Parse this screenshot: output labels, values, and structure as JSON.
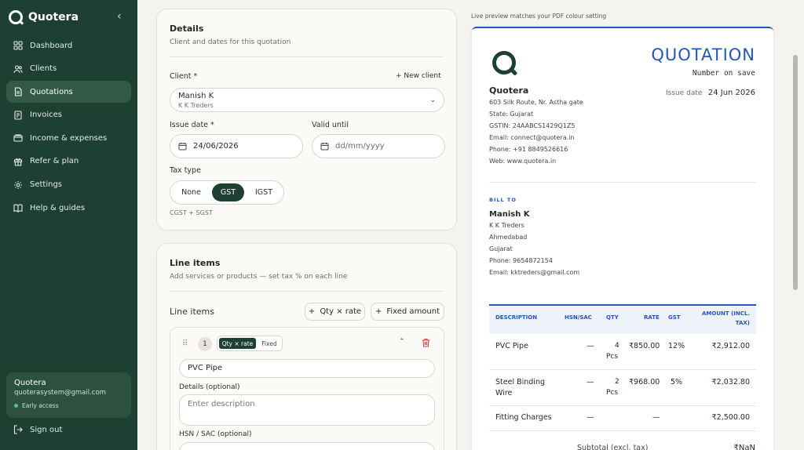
{
  "sidebar": {
    "brand": "Quotera",
    "items": [
      {
        "label": "Dashboard",
        "icon": "grid-icon",
        "active": false
      },
      {
        "label": "Clients",
        "icon": "users-icon",
        "active": false
      },
      {
        "label": "Quotations",
        "icon": "document-icon",
        "active": true
      },
      {
        "label": "Invoices",
        "icon": "invoice-icon",
        "active": false
      },
      {
        "label": "Income & expenses",
        "icon": "wallet-icon",
        "active": false
      },
      {
        "label": "Refer & plan",
        "icon": "gift-icon",
        "active": false
      },
      {
        "label": "Settings",
        "icon": "gear-icon",
        "active": false
      },
      {
        "label": "Help & guides",
        "icon": "book-icon",
        "active": false
      }
    ],
    "account": {
      "name": "Quotera",
      "email": "quoterasystem@gmail.com",
      "status": "Early access"
    },
    "signout": "Sign out"
  },
  "details": {
    "title": "Details",
    "subtitle": "Client and dates for this quotation",
    "client_label": "Client *",
    "new_client": "+ New client",
    "client_name": "Manish K",
    "client_company": "K K Treders",
    "issue_label": "Issue date *",
    "issue_value": "24/06/2026",
    "valid_label": "Valid until",
    "valid_placeholder": "dd/mm/yyyy",
    "tax_label": "Tax type",
    "tax_options": [
      "None",
      "GST",
      "IGST"
    ],
    "tax_selected": "GST",
    "tax_note": "CGST + SGST"
  },
  "line_items": {
    "title": "Line items",
    "subtitle": "Add services or products — set tax % on each line",
    "section_label": "Line items",
    "qty_rate_btn": "Qty × rate",
    "fixed_btn": "Fixed amount",
    "item": {
      "number": "1",
      "mode_options": [
        "Qty × rate",
        "Fixed"
      ],
      "mode_selected": "Qty × rate",
      "name": "PVC Pipe",
      "details_label": "Details (optional)",
      "details_placeholder": "Enter description",
      "hsn_label": "HSN / SAC  (optional)"
    }
  },
  "preview": {
    "note": "Live preview matches your PDF colour setting",
    "doc_title": "QUOTATION",
    "doc_number": "Number on save",
    "company": {
      "name": "Quotera",
      "lines": [
        "603 Silk Route, Nr. Astha gate",
        "State: Gujarat",
        "GSTIN: 24AABCS1429Q1Z5",
        "Email: connect@quotera.in",
        "Phone: +91 8849526616",
        "Web: www.quotera.in"
      ]
    },
    "issue_label": "Issue date",
    "issue_value": "24 Jun 2026",
    "bill_to_label": "BILL TO",
    "bill_to": {
      "name": "Manish K",
      "lines": [
        "K K Treders",
        "Ahmedabad",
        "Gujarat",
        "Phone: 9654872154",
        "Email: kktreders@gmail.com"
      ]
    },
    "table": {
      "headers": [
        "DESCRIPTION",
        "HSN/SAC",
        "QTY",
        "RATE",
        "GST",
        "AMOUNT (INCL.",
        "TAX)"
      ],
      "rows": [
        {
          "desc": [
            "PVC Pipe"
          ],
          "hsn": "—",
          "qty": [
            "4",
            "Pcs"
          ],
          "rate": "₹850.00",
          "gst": "12%",
          "amount": "₹2,912.00"
        },
        {
          "desc": [
            "Steel Binding",
            "Wire"
          ],
          "hsn": "—",
          "qty": [
            "2",
            "Pcs"
          ],
          "rate": "₹968.00",
          "gst": "5%",
          "amount": "₹2,032.80"
        },
        {
          "desc": [
            "Fitting Charges"
          ],
          "hsn": "—",
          "qty": [
            ""
          ],
          "rate": "—",
          "gst": "",
          "amount": "₹2,500.00"
        }
      ]
    },
    "subtotal_label": "Subtotal (excl. tax)",
    "subtotal_value": "₹NaN"
  },
  "colors": {
    "sidebar": "#1e4032",
    "accent_blue": "#2456b8",
    "active_green": "#1e4032"
  }
}
